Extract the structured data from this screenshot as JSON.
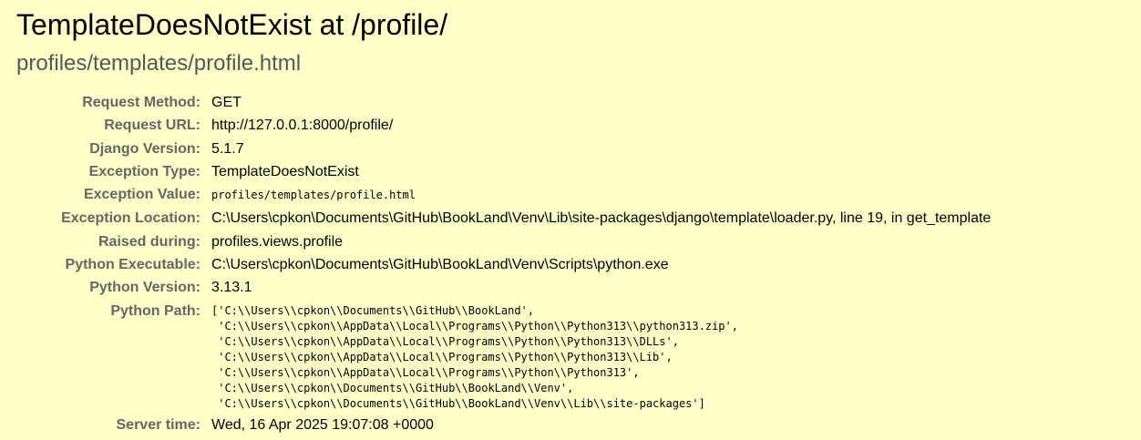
{
  "page": {
    "title": "TemplateDoesNotExist at /profile/",
    "subtitle": "profiles/templates/profile.html"
  },
  "meta": {
    "request_method": {
      "label": "Request Method:",
      "value": "GET"
    },
    "request_url": {
      "label": "Request URL:",
      "value": "http://127.0.0.1:8000/profile/"
    },
    "django_version": {
      "label": "Django Version:",
      "value": "5.1.7"
    },
    "exception_type": {
      "label": "Exception Type:",
      "value": "TemplateDoesNotExist"
    },
    "exception_value": {
      "label": "Exception Value:",
      "value": "profiles/templates/profile.html"
    },
    "exception_location": {
      "label": "Exception Location:",
      "value": "C:\\Users\\cpkon\\Documents\\GitHub\\BookLand\\Venv\\Lib\\site-packages\\django\\template\\loader.py, line 19, in get_template"
    },
    "raised_during": {
      "label": "Raised during:",
      "value": "profiles.views.profile"
    },
    "python_executable": {
      "label": "Python Executable:",
      "value": "C:\\Users\\cpkon\\Documents\\GitHub\\BookLand\\Venv\\Scripts\\python.exe"
    },
    "python_version": {
      "label": "Python Version:",
      "value": "3.13.1"
    },
    "python_path": {
      "label": "Python Path:",
      "value": "['C:\\\\Users\\\\cpkon\\\\Documents\\\\GitHub\\\\BookLand',\n 'C:\\\\Users\\\\cpkon\\\\AppData\\\\Local\\\\Programs\\\\Python\\\\Python313\\\\python313.zip',\n 'C:\\\\Users\\\\cpkon\\\\AppData\\\\Local\\\\Programs\\\\Python\\\\Python313\\\\DLLs',\n 'C:\\\\Users\\\\cpkon\\\\AppData\\\\Local\\\\Programs\\\\Python\\\\Python313\\\\Lib',\n 'C:\\\\Users\\\\cpkon\\\\AppData\\\\Local\\\\Programs\\\\Python\\\\Python313',\n 'C:\\\\Users\\\\cpkon\\\\Documents\\\\GitHub\\\\BookLand\\\\Venv',\n 'C:\\\\Users\\\\cpkon\\\\Documents\\\\GitHub\\\\BookLand\\\\Venv\\\\Lib\\\\site-packages']"
    },
    "server_time": {
      "label": "Server time:",
      "value": "Wed, 16 Apr 2025 19:07:08 +0000"
    }
  },
  "colors": {
    "background": "#ffffc8",
    "label": "#666666",
    "subtitle": "#575757"
  }
}
